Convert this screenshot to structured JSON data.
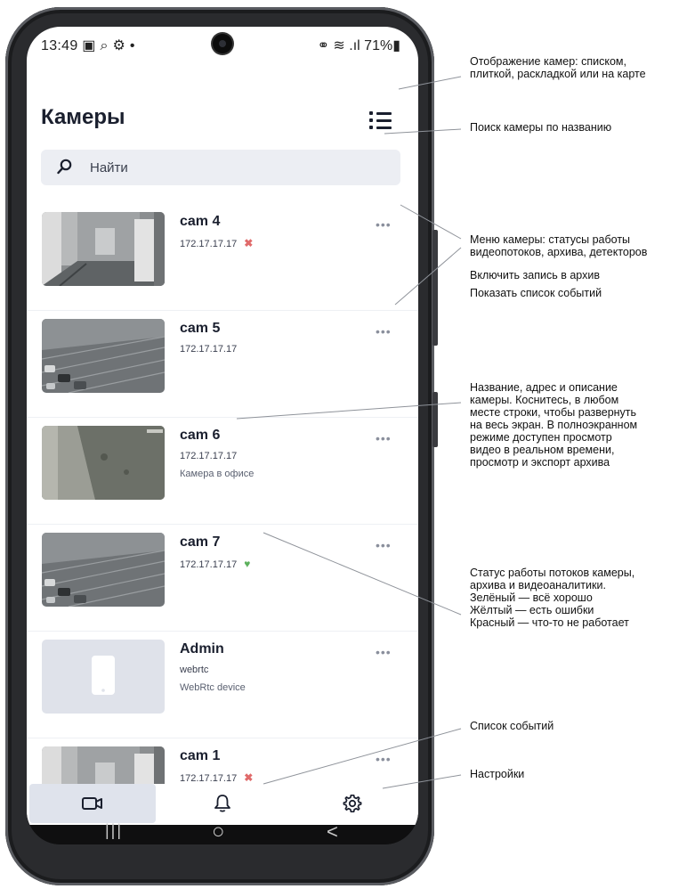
{
  "status_bar": {
    "time_icons": "13:49 ▣ ⌕ ⚙ •",
    "right": "⚭ ≋ .ıl 71%▮"
  },
  "app": {
    "title": "Камеры",
    "search_placeholder": "Найти",
    "cameras": [
      {
        "name": "cam 4",
        "address": "172.17.17.17",
        "description": "",
        "status": "error",
        "status_glyph": "✖",
        "thumb": "room"
      },
      {
        "name": "cam 5",
        "address": "172.17.17.17",
        "description": "",
        "status": "none",
        "status_glyph": "",
        "thumb": "road"
      },
      {
        "name": "cam 6",
        "address": "172.17.17.17",
        "description": "Камера в офисе",
        "status": "none",
        "status_glyph": "",
        "thumb": "street"
      },
      {
        "name": "cam 7",
        "address": "172.17.17.17",
        "description": "",
        "status": "ok",
        "status_glyph": "♥",
        "thumb": "road"
      },
      {
        "name": "Admin",
        "address": "webrtc",
        "description": "WebRtc device",
        "status": "none",
        "status_glyph": "",
        "thumb": "device"
      },
      {
        "name": "cam 1",
        "address": "172.17.17.17",
        "description": "",
        "status": "error",
        "status_glyph": "✖",
        "thumb": "room"
      }
    ],
    "more_glyph": "•••",
    "tabs": [
      {
        "icon": "video-camera-icon",
        "active": true
      },
      {
        "icon": "bell-icon",
        "active": false
      },
      {
        "icon": "gear-icon",
        "active": false
      }
    ]
  },
  "nav": {
    "recent": "|||",
    "home": "○",
    "back": "<"
  },
  "annotations": {
    "view_mode": [
      "Отображение камер: списком,",
      "плиткой,  раскладкой или на карте"
    ],
    "search": [
      "Поиск камеры по названию"
    ],
    "menu": [
      "Меню камеры: статусы работы",
      "видеопотоков, архива, детекторов"
    ],
    "record": [
      "Включить запись в архив"
    ],
    "events_list": [
      "Показать список событий"
    ],
    "name_desc": [
      "Название, адрес и описание",
      "камеры. Коснитесь, в любом",
      "месте строки, чтобы развернуть",
      "на весь экран. В полноэкранном",
      "режиме доступен просмотр",
      "видео в реальном времени,",
      "просмотр и экспорт архива"
    ],
    "status": [
      "Статус работы потоков камеры,",
      "архива и видеоаналитики.",
      "Зелёный — всё хорошо",
      "Жёлтый — есть ошибки",
      "Красный — что-то не работает"
    ],
    "events_tab": [
      "Список событий"
    ],
    "settings_tab": [
      "Настройки"
    ]
  },
  "colors": {
    "accent_bg": "#dfe3ec",
    "status_error": "#e06a6a",
    "status_ok": "#5cb05c"
  }
}
